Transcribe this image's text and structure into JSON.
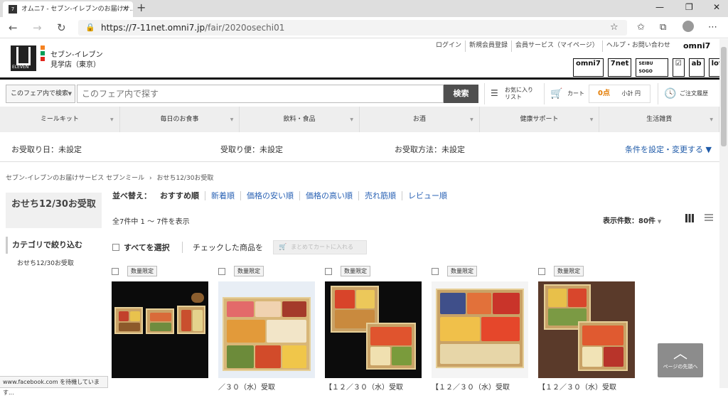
{
  "browser": {
    "tab_title": "オムニ7 - セブン-イレブンのお届けサ…",
    "favicon": "omni7-favicon",
    "url_host": "https://7-11net.omni7.jp",
    "url_path": "/fair/2020osechi01",
    "status_text": "www.facebook.com を待機しています..."
  },
  "site": {
    "store_name": "セブン-イレブン",
    "store_branch": "見学店（東京）",
    "top_links": [
      "ログイン",
      "新規会員登録",
      "会員サービス（マイページ）",
      "ヘルプ・お問い合わせ"
    ],
    "omni_brand": "omni7",
    "brand_logos": [
      "omni7",
      "7net",
      "SEIBU SOGO",
      "☑",
      "ab",
      "loft"
    ],
    "accent_color": "#e37b00",
    "link_color": "#2a62b4"
  },
  "search": {
    "scope_label": "このフェア内で検索",
    "placeholder": "このフェア内で探す",
    "button": "検索",
    "favorites_line1": "お気に入り",
    "favorites_line2": "リスト",
    "cart": "カート",
    "points": "0点",
    "subtotal": "小計 円",
    "history": "ご注文履歴"
  },
  "categories": [
    "ミールキット",
    "毎日のお食事",
    "飲料・食品",
    "お酒",
    "健康サポート",
    "生活雑貨"
  ],
  "delivery": {
    "date": "お受取り日：未設定",
    "slot": "受取り便：未設定",
    "method": "お受取方法：未設定",
    "change": "条件を設定・変更する ▼"
  },
  "breadcrumb": {
    "parent": "セブン-イレブンのお届けサービス セブンミール",
    "sep": "›",
    "current": "おせち12/30お受取"
  },
  "sidebar": {
    "title": "おせち12/30お受取",
    "filter_heading": "カテゴリで絞り込む",
    "items": [
      "おせち12/30お受取"
    ]
  },
  "listing": {
    "sort_label": "並べ替え：",
    "sort_options": [
      "おすすめ順",
      "新着順",
      "価格の安い順",
      "価格の高い順",
      "売れ筋順",
      "レビュー順"
    ],
    "count_text": "全7件中 1 〜 7件を表示",
    "per_page": "表示件数：80件",
    "select_all": "すべてを選択",
    "checked_action": "チェックした商品を",
    "bulk_cart": "まとめてカートに入れる",
    "to_top": "ページの先頭へ"
  },
  "products": [
    {
      "badge": "数量限定",
      "title": ""
    },
    {
      "badge": "数量限定",
      "title": "／３０（水）受取"
    },
    {
      "badge": "数量限定",
      "title": "【１２／３０（水）受取"
    },
    {
      "badge": "数量限定",
      "title": "【１２／３０（水）受取"
    },
    {
      "badge": "数量限定",
      "title": "【１２／３０（水）受取"
    }
  ]
}
